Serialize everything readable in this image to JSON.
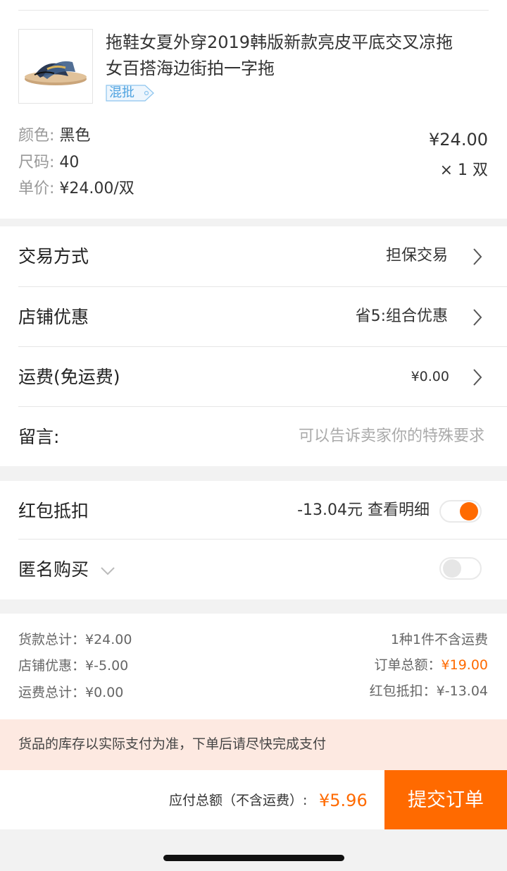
{
  "product": {
    "title_line1": "拖鞋女夏外穿2019韩版新款亮皮平底交叉凉拖",
    "title_line2": "女百搭海边街拍一字拖",
    "badge": "混批",
    "image_icon": "sandal-image",
    "color_label": "颜色: ",
    "color_value": "黑色",
    "size_label": "尺码: ",
    "size_value": "40",
    "unit_price_label": "单价: ",
    "unit_price_value": "¥24.00/双",
    "price": "¥24.00",
    "quantity": "× 1 双"
  },
  "options": {
    "trade_label": "交易方式",
    "trade_value": "担保交易",
    "shop_discount_label": "店铺优惠",
    "shop_discount_value": "省5:组合优惠",
    "shipping_label": "运费(免运费)",
    "shipping_value": "¥0.00",
    "message_label": "留言:",
    "message_placeholder": "可以告诉卖家你的特殊要求"
  },
  "redpacket": {
    "label": "红包抵扣",
    "value": "-13.04元 查看明细",
    "enabled": true
  },
  "anonymous": {
    "label": "匿名购买",
    "enabled": false
  },
  "summary": {
    "goods_total": "货款总计：¥24.00",
    "shop_discount": "店铺优惠：¥-5.00",
    "shipping_total": "运费总计：¥0.00",
    "count_note": "1种1件不含运费",
    "order_total_label": "订单总额：",
    "order_total_value": "¥19.00",
    "redpacket_deduct": "红包抵扣：¥-13.04"
  },
  "notice": "货品的库存以实际支付为准，下单后请尽快完成支付",
  "footer": {
    "payable_label": "应付总额（不含运费）:",
    "payable_value": "¥5.96",
    "submit_label": "提交订单"
  },
  "colors": {
    "accent": "#ff6a00",
    "notice_bg": "#fde9e1",
    "badge": "#6fb3e8"
  }
}
